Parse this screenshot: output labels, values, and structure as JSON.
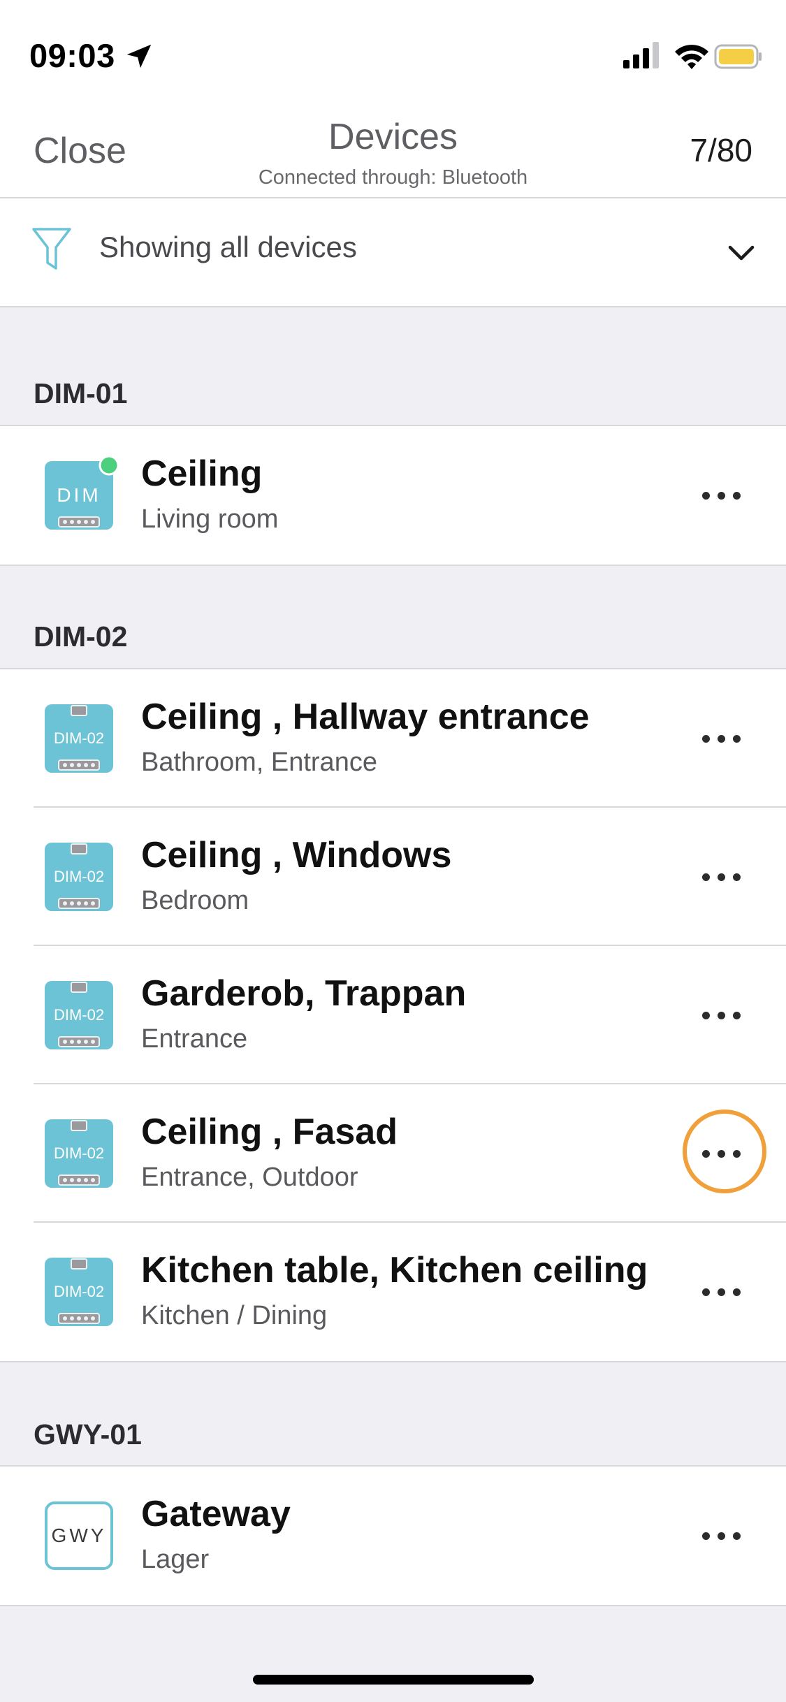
{
  "status_bar": {
    "time": "09:03"
  },
  "nav": {
    "close_label": "Close",
    "title": "Devices",
    "subtitle": "Connected through: Bluetooth",
    "count": "7/80"
  },
  "filter": {
    "label": "Showing all devices"
  },
  "sections": [
    {
      "header": "DIM-01",
      "devices": [
        {
          "name": "Ceiling",
          "room": "Living room",
          "badge": "DIM"
        }
      ]
    },
    {
      "header": "DIM-02",
      "devices": [
        {
          "name": "Ceiling , Hallway entrance",
          "room": "Bathroom, Entrance",
          "badge": "DIM-02"
        },
        {
          "name": "Ceiling , Windows",
          "room": "Bedroom",
          "badge": "DIM-02"
        },
        {
          "name": "Garderob, Trappan",
          "room": "Entrance",
          "badge": "DIM-02"
        },
        {
          "name": "Ceiling , Fasad",
          "room": "Entrance, Outdoor",
          "badge": "DIM-02"
        },
        {
          "name": "Kitchen table, Kitchen ceiling",
          "room": "Kitchen / Dining",
          "badge": "DIM-02"
        }
      ]
    },
    {
      "header": "GWY-01",
      "devices": [
        {
          "name": "Gateway",
          "room": "Lager",
          "badge": "GWY"
        }
      ]
    }
  ],
  "colors": {
    "device_tile": "#6cc3d5",
    "online_dot": "#4cd07d",
    "highlight_ring": "#f0a03a",
    "battery": "#f4cf45"
  }
}
